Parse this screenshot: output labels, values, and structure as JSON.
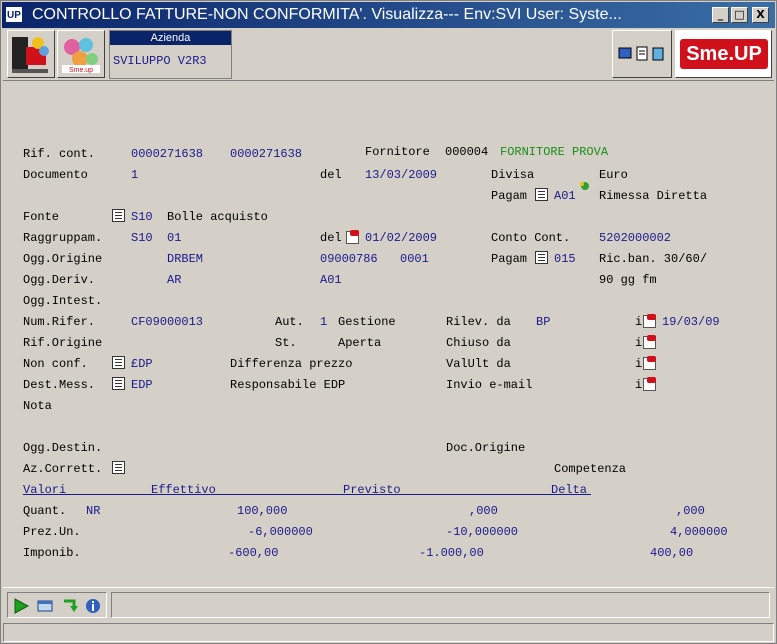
{
  "window": {
    "app_icon": "UP",
    "title": "CONTROLLO FATTURE-NON CONFORMITA'.  Visualizza--- Env:SVI User:      Syste...",
    "minimize": "_",
    "maximize": "□",
    "close": "X"
  },
  "toolbar": {
    "azienda_label": "Azienda",
    "azienda_value": "SVILUPPO V2R3",
    "brand": "Sme.UP"
  },
  "form": {
    "rif_cont_label": "Rif. cont.",
    "rif_cont_1": "0000271638",
    "rif_cont_2": "0000271638",
    "fornitore_label": "Fornitore",
    "fornitore_code": "000004",
    "fornitore_name": "FORNITORE PROVA",
    "documento_label": "Documento",
    "documento_value": "1",
    "del_label": "del",
    "documento_date": "13/03/2009",
    "divisa_label": "Divisa",
    "divisa_value": "Euro",
    "pagam_label": "Pagam",
    "pagam_code": "A01",
    "pagam_desc": "Rimessa Diretta",
    "fonte_label": "Fonte",
    "fonte_code": "S10",
    "fonte_desc": "Bolle acquisto",
    "raggruppam_label": "Raggruppam.",
    "raggruppam_code": "S10",
    "raggruppam_num": "01",
    "del2_label": "del",
    "raggruppam_date": "01/02/2009",
    "conto_label": "Conto Cont.",
    "conto_value": "5202000002",
    "ogg_origine_label": "Ogg.Origine",
    "ogg_origine_value": "DRBEM",
    "ogg_origine_num": "09000786",
    "ogg_origine_num2": "0001",
    "pagam2_label": "Pagam",
    "pagam2_code": "015",
    "pagam2_desc1": "Ric.ban. 30/60/",
    "pagam2_desc2": "90 gg fm",
    "ogg_deriv_label": "Ogg.Deriv.",
    "ogg_deriv_value": "AR",
    "ogg_deriv_code": "A01",
    "ogg_intest_label": "Ogg.Intest.",
    "num_rifer_label": "Num.Rifer.",
    "num_rifer_value": "CF09000013",
    "aut_label": "Aut.",
    "aut_value": "1",
    "aut_desc": "Gestione",
    "rilev_label": "Rilev. da",
    "rilev_value": "BP",
    "i_label": "i",
    "rilev_date": "19/03/09",
    "rif_origine_label": "Rif.Origine",
    "st_label": "St.",
    "st_value": "Aperta",
    "chiuso_label": "Chiuso da",
    "non_conf_label": "Non conf.",
    "non_conf_code": "£DP",
    "non_conf_desc": "Differenza prezzo",
    "valult_label": "ValUlt da",
    "dest_mess_label": "Dest.Mess.",
    "dest_mess_code": "EDP",
    "dest_mess_desc": "Responsabile EDP",
    "invio_label": "Invio e-mail",
    "nota_label": "Nota",
    "ogg_destin_label": "Ogg.Destin.",
    "doc_origine_label": "Doc.Origine",
    "az_corrett_label": "Az.Corrett.",
    "competenza_label": "Competenza"
  },
  "values_table": {
    "headers": [
      "Valori",
      "Effettivo",
      "Previsto",
      "Delta"
    ],
    "rows": [
      {
        "label": "Quant.",
        "unit": "NR",
        "effettivo": "100,000",
        "previsto": ",000",
        "delta": ",000"
      },
      {
        "label": "Prez.Un.",
        "unit": "",
        "effettivo": "-6,000000",
        "previsto": "-10,000000",
        "delta": "4,000000"
      },
      {
        "label": "Imponib.",
        "unit": "",
        "effettivo": "-600,00",
        "previsto": "-1.000,00",
        "delta": "400,00"
      }
    ]
  },
  "icons": {
    "run": "play-icon",
    "window": "window-icon",
    "refresh": "refresh-icon",
    "info": "info-icon"
  }
}
